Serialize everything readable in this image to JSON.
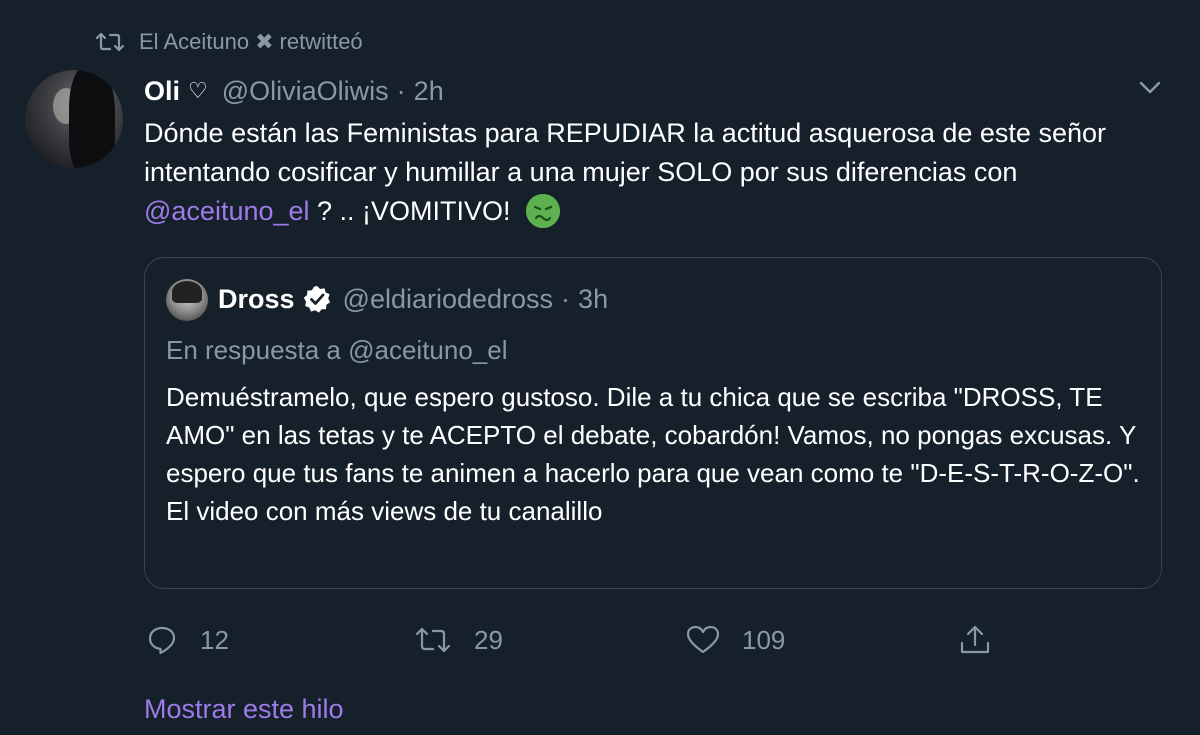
{
  "retweet": {
    "icon": "retweet-icon",
    "user": "El Aceituno",
    "user_badge": "✖",
    "action": "retwitteó"
  },
  "tweet": {
    "author_name": "Oli",
    "author_badge": "♡",
    "author_handle": "@OliviaOliwis",
    "separator": "·",
    "time": "2h",
    "text_part1": "Dónde están las Feministas para REPUDIAR la actitud asquerosa de este señor intentando cosificar y humillar a una mujer SOLO por sus diferencias con ",
    "mention": "@aceituno_el",
    "text_part2": " ? .. ¡VOMITIVO! ",
    "emoji": "nauseated-face-emoji",
    "menu_icon": "chevron-down-icon"
  },
  "quoted": {
    "author_name": "Dross",
    "author_handle": "@eldiariodedross",
    "separator": "·",
    "time": "3h",
    "reply_to_label": "En respuesta a @aceituno_el",
    "text": "Demuéstramelo, que espero gustoso. Dile a tu chica que se escriba \"DROSS, TE AMO\" en las tetas y te ACEPTO el debate, cobardón! Vamos, no pongas excusas.  Y espero que tus fans te animen a hacerlo para que vean como te \"D-E-S-T-R-O-Z-O\". El video con más views de tu canalillo"
  },
  "actions": {
    "reply_count": "12",
    "retweet_count": "29",
    "like_count": "109"
  },
  "show_thread": "Mostrar este hilo",
  "colors": {
    "background": "#15202b",
    "muted": "#8899a6",
    "accent": "#9d7be8",
    "border": "#38444d"
  }
}
